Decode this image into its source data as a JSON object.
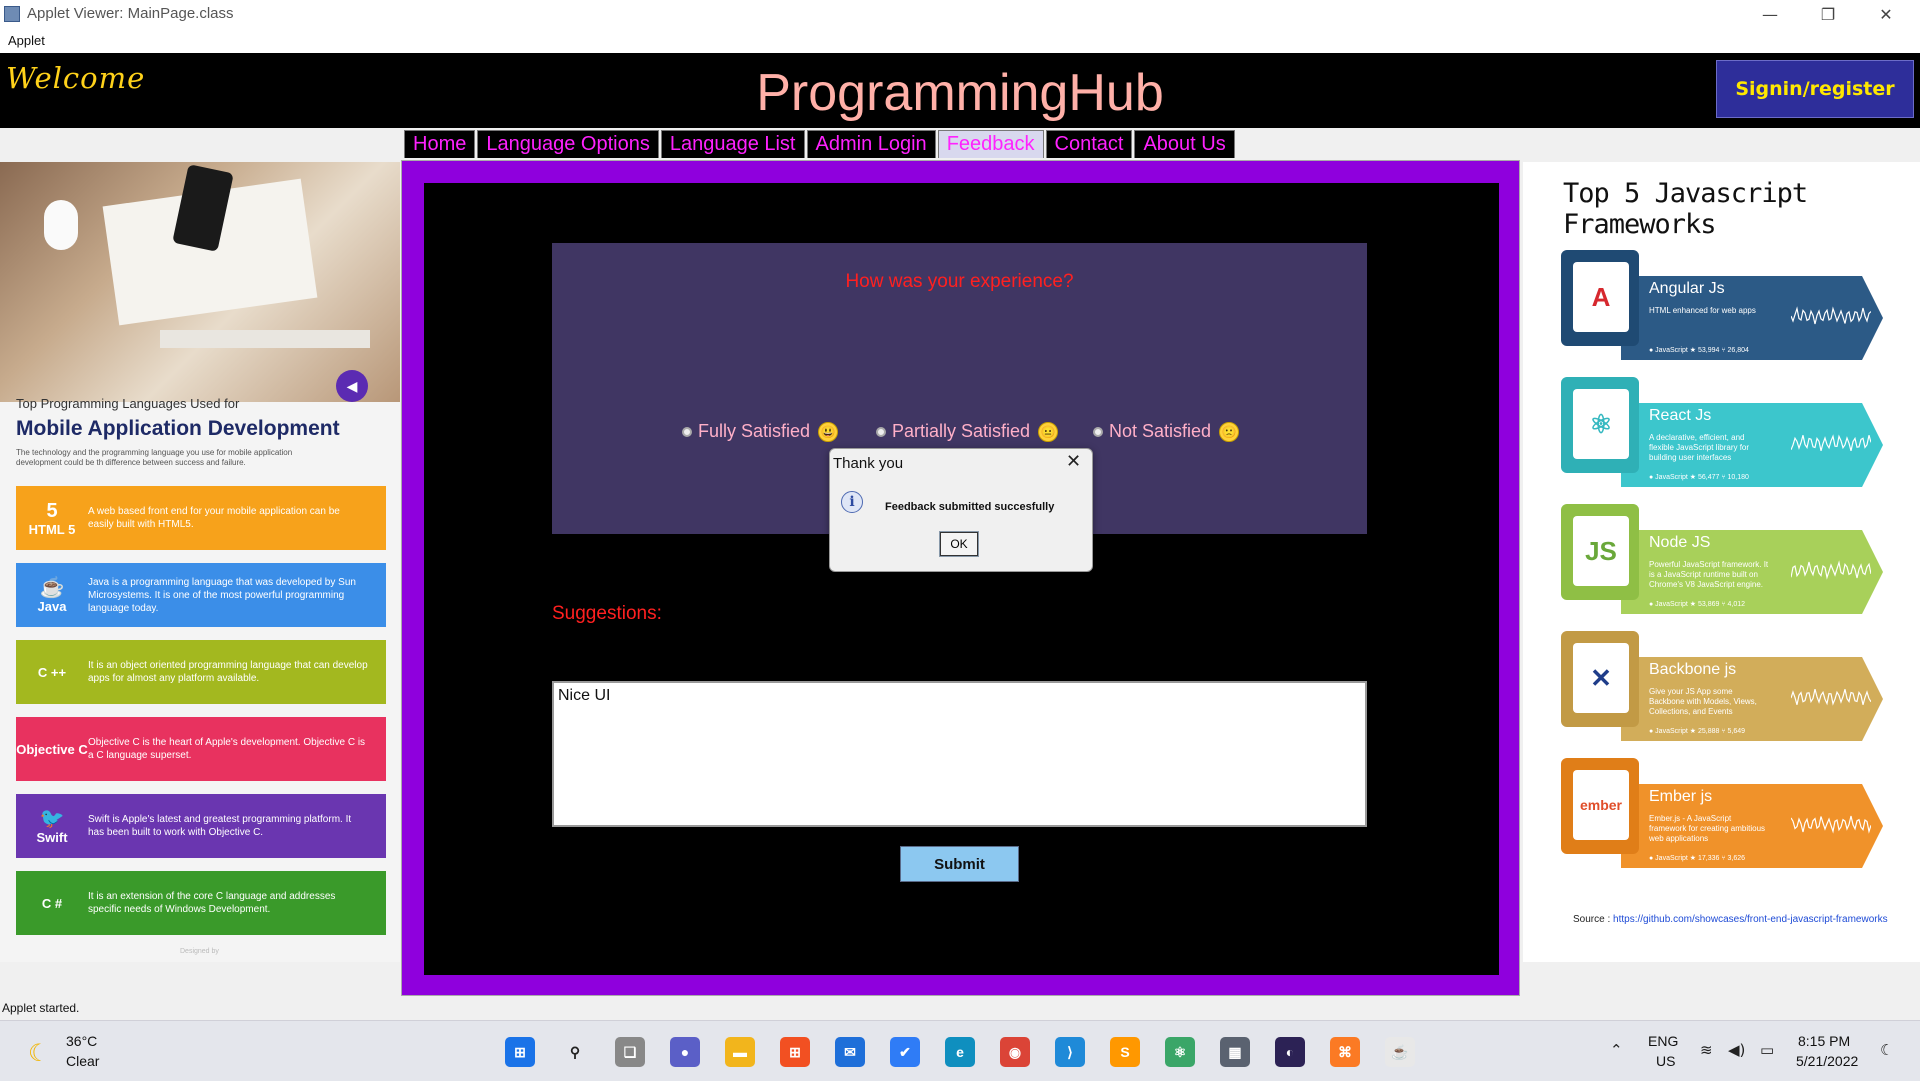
{
  "window": {
    "title": "Applet Viewer: MainPage.class",
    "menu": "Applet",
    "min": "—",
    "restore": "❐",
    "close": "✕"
  },
  "header": {
    "welcome": "Welcome",
    "title": "ProgrammingHub",
    "signin": "Signin/register"
  },
  "nav": {
    "tabs": [
      "Home",
      "Language Options",
      "Language List",
      "Admin Login",
      "Feedback",
      "Contact",
      "About Us"
    ],
    "active": "Feedback"
  },
  "left_panel": {
    "heading_small": "Top Programming Languages Used for",
    "heading_big": "Mobile Application Development",
    "desc": "The technology and the programming language you use for mobile application development could be th difference between success and failure.",
    "languages": [
      {
        "name": "HTML 5",
        "icon": "5",
        "color": "#f7a21b",
        "text": "A web based front end for your mobile application can be easily built with HTML5."
      },
      {
        "name": "Java",
        "icon": "☕",
        "color": "#3b8ee8",
        "text": "Java is a programming language that was developed by Sun Microsystems. It is one of the most powerful programming language today."
      },
      {
        "name": "C ++",
        "icon": "",
        "color": "#a3b81f",
        "text": "It is an object oriented programming language that can develop apps for almost any platform available."
      },
      {
        "name": "Objective C",
        "icon": "",
        "color": "#e8325f",
        "text": "Objective C is the heart of Apple's development. Objective C is a C language superset."
      },
      {
        "name": "Swift",
        "icon": "🐦",
        "color": "#6a36b0",
        "text": "Swift is Apple's latest and greatest programming platform. It has been built to work with Objective C."
      },
      {
        "name": "C #",
        "icon": "",
        "color": "#3a9a2a",
        "text": "It is an extension of the core C language and addresses specific needs of Windows Development."
      }
    ],
    "footer": "Designed by"
  },
  "feedback": {
    "question": "How was your experience?",
    "options": [
      "Fully Satisfied",
      "Partially Satisfied",
      "Not Satisfied"
    ],
    "option_emoji": [
      "😃",
      "😐",
      "🙁"
    ],
    "suggestions_label": "Suggestions:",
    "suggestions_value": "Nice UI",
    "submit": "Submit"
  },
  "dialog": {
    "title": "Thank you",
    "message": "Feedback submitted succesfully",
    "ok": "OK",
    "icon": "i"
  },
  "right_panel": {
    "title": "Top 5 Javascript Frameworks",
    "frameworks": [
      {
        "name": "Angular Js",
        "desc": "HTML enhanced for web apps",
        "meta": "● JavaScript ★ 53,994 ⑂ 26,804",
        "color": "#2c5a86",
        "box": "#1f4a73",
        "icon": "A",
        "icon_color": "#d6282e"
      },
      {
        "name": "React Js",
        "desc": "A declarative, efficient, and flexible JavaScript library for building user interfaces",
        "meta": "● JavaScript ★ 56,477 ⑂ 10,180",
        "color": "#3cc6cc",
        "box": "#2fb0b6",
        "icon": "⚛",
        "icon_color": "#35b8c0"
      },
      {
        "name": "Node JS",
        "desc": "Powerful JavaScript framework. It is a JavaScript runtime built on Chrome's V8 JavaScript engine.",
        "meta": "● JavaScript ★ 53,869 ⑂ 4,012",
        "color": "#a8d05a",
        "box": "#8fbf45",
        "icon": "JS",
        "icon_color": "#6aa83a"
      },
      {
        "name": "Backbone js",
        "desc": "Give your JS App some Backbone with Models, Views, Collections, and Events",
        "meta": "● JavaScript ★ 25,888 ⑂ 5,649",
        "color": "#d2ad5a",
        "box": "#c29a45",
        "icon": "✕",
        "icon_color": "#1f3d8a"
      },
      {
        "name": "Ember js",
        "desc": "Ember.js - A JavaScript framework for creating ambitious web applications",
        "meta": "● JavaScript ★ 17,336 ⑂ 3,626",
        "color": "#f0922a",
        "box": "#e07e18",
        "icon": "ember",
        "icon_color": "#e04e2a"
      }
    ],
    "source_label": "Source : ",
    "source_link": "https://github.com/showcases/front-end-javascript-frameworks"
  },
  "status": "Applet started.",
  "taskbar": {
    "temp": "36°C",
    "condition": "Clear",
    "lang1": "ENG",
    "lang2": "US",
    "time": "8:15 PM",
    "date": "5/21/2022",
    "apps": [
      {
        "name": "start",
        "color": "#1a73e8",
        "glyph": "⊞"
      },
      {
        "name": "search",
        "color": "#e4e6ec",
        "glyph": "⚲"
      },
      {
        "name": "task-view",
        "color": "#888888",
        "glyph": "❏"
      },
      {
        "name": "chat",
        "color": "#5b5fc7",
        "glyph": "●"
      },
      {
        "name": "file-explorer",
        "color": "#f2b51c",
        "glyph": "▬"
      },
      {
        "name": "store",
        "color": "#f25022",
        "glyph": "⊞"
      },
      {
        "name": "mail",
        "color": "#1e6fd9",
        "glyph": "✉"
      },
      {
        "name": "todo",
        "color": "#2f7cf6",
        "glyph": "✔"
      },
      {
        "name": "edge",
        "color": "#0f8fbf",
        "glyph": "e"
      },
      {
        "name": "chrome",
        "color": "#db4437",
        "glyph": "◉"
      },
      {
        "name": "vscode",
        "color": "#1f8ad8",
        "glyph": "⟩"
      },
      {
        "name": "sublime",
        "color": "#ff9800",
        "glyph": "S"
      },
      {
        "name": "atom",
        "color": "#3aa668",
        "glyph": "⚛"
      },
      {
        "name": "calculator",
        "color": "#5a6270",
        "glyph": "▦"
      },
      {
        "name": "eclipse",
        "color": "#2c2255",
        "glyph": "◐"
      },
      {
        "name": "xampp",
        "color": "#fb7a24",
        "glyph": "⌘"
      },
      {
        "name": "java",
        "color": "#e8e8e8",
        "glyph": "☕"
      }
    ]
  }
}
